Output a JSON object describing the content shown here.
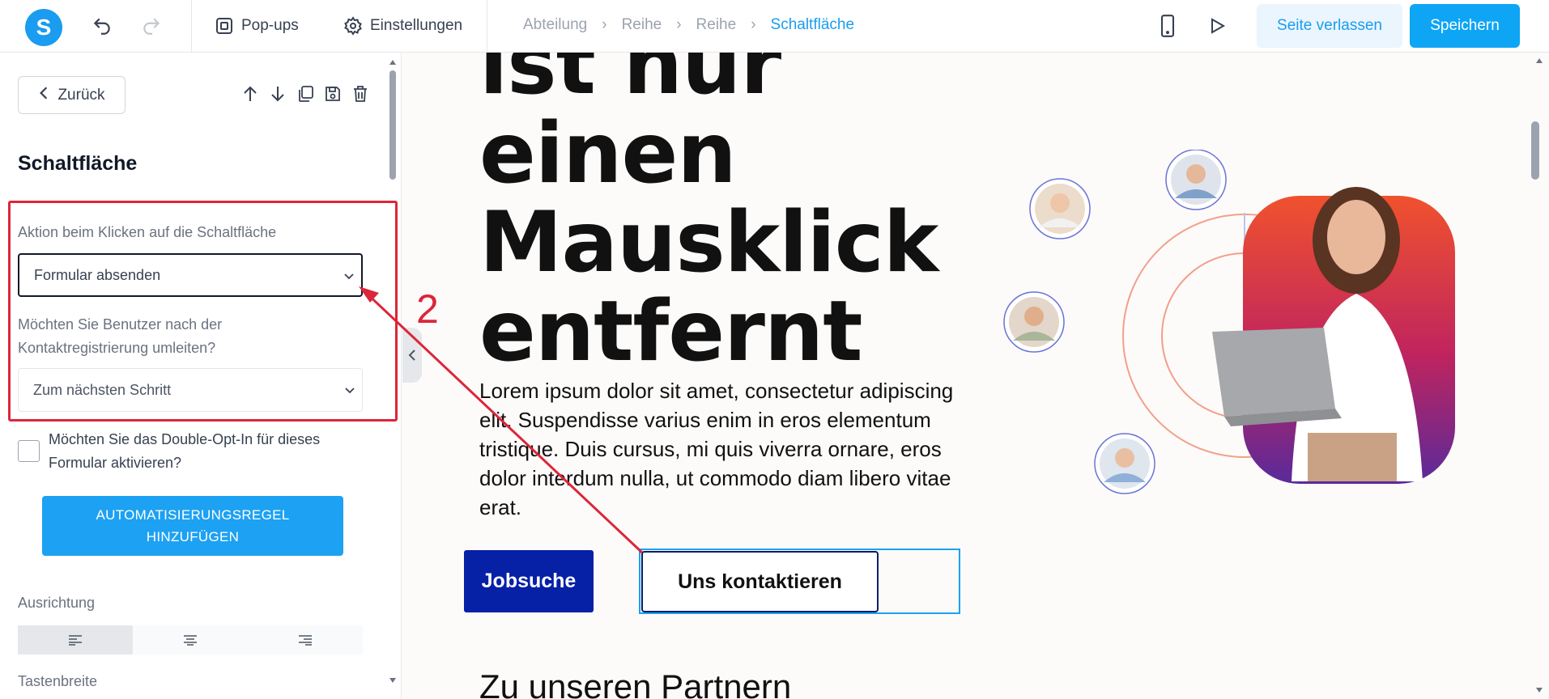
{
  "topbar": {
    "logo_letter": "S",
    "popups_label": "Pop-ups",
    "settings_label": "Einstellungen",
    "breadcrumb": [
      "Abteilung",
      "Reihe",
      "Reihe",
      "Schaltfläche"
    ],
    "leave_label": "Seite verlassen",
    "save_label": "Speichern"
  },
  "sidebar": {
    "back_label": "Zurück",
    "title": "Schaltfläche",
    "click_action_label": "Aktion beim Klicken auf die Schaltfläche",
    "click_action_value": "Formular absenden",
    "redirect_label_1": "Möchten Sie Benutzer nach der",
    "redirect_label_2": "Kontaktregistrierung umleiten?",
    "redirect_value": "Zum nächsten Schritt",
    "double_opt_in_1": "Möchten Sie das Double-Opt-In für dieses",
    "double_opt_in_2": "Formular aktivieren?",
    "automation_1": "AUTOMATISIERUNGSREGEL",
    "automation_2": "HINZUFÜGEN",
    "alignment_label": "Ausrichtung",
    "button_width_label": "Tastenbreite"
  },
  "canvas": {
    "hero_lines": [
      "ist nur",
      "einen",
      "Mausklick",
      "entfernt"
    ],
    "paragraph": "Lorem ipsum dolor sit amet, consectetur adipiscing elit. Suspendisse varius enim in eros elementum tristique. Duis cursus, mi quis viverra ornare, eros dolor interdum nulla, ut commodo diam libero vitae erat.",
    "job_button": "Jobsuche",
    "contact_button": "Uns kontaktieren",
    "partners_heading": "Zu unseren Partnern"
  },
  "annotation": {
    "step_number": "2"
  },
  "colors": {
    "accent": "#1a9cf0",
    "primary_dark": "#0620a6",
    "annotation_red": "#dc2639"
  }
}
